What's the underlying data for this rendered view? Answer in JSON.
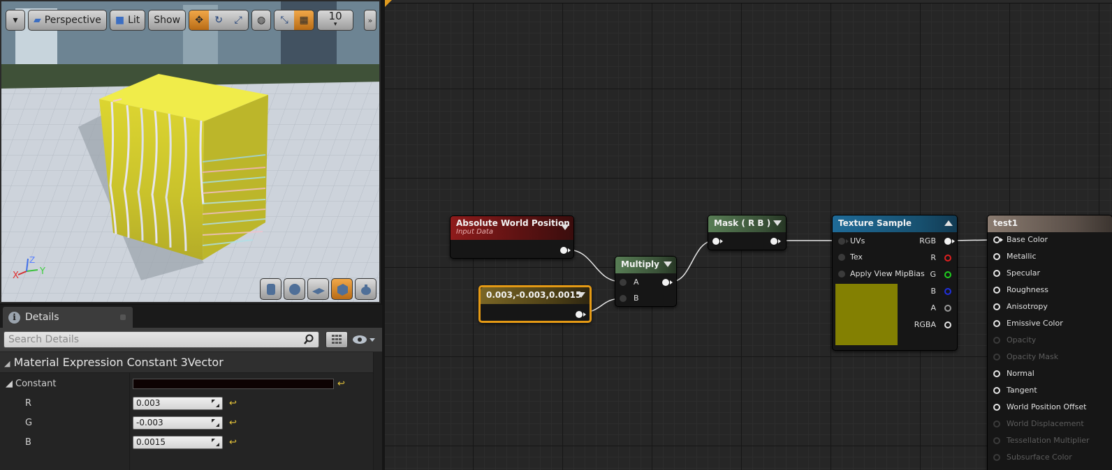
{
  "viewport": {
    "toolbar": {
      "perspective_label": "Perspective",
      "lit_label": "Lit",
      "show_label": "Show",
      "grid_snap_value": "10"
    },
    "axis": {
      "x": "X",
      "y": "Y",
      "z": "Z"
    }
  },
  "details": {
    "tab_title": "Details",
    "search_placeholder": "Search Details",
    "category_title": "Material Expression Constant 3Vector",
    "constant_label": "Constant",
    "constant_color": "#0d0202",
    "fields": [
      {
        "label": "R",
        "value": "0.003"
      },
      {
        "label": "G",
        "value": "-0.003"
      },
      {
        "label": "B",
        "value": "0.0015"
      }
    ]
  },
  "graph": {
    "nodes": {
      "absolute_world_position": {
        "title": "Absolute World Position",
        "subtitle": "Input Data",
        "color": "#8e1b1b"
      },
      "constant3": {
        "title": "0.003,-0.003,0.0015",
        "color": "#6a5a1e",
        "highlight": "#e59a14"
      },
      "multiply": {
        "title": "Multiply",
        "inputs": [
          "A",
          "B"
        ],
        "color": "#4d6b4a"
      },
      "mask": {
        "title": "Mask ( R B )",
        "color": "#4d6b4a"
      },
      "texture_sample": {
        "title": "Texture Sample",
        "inputs": [
          "UVs",
          "Tex",
          "Apply View MipBias"
        ],
        "outputs": [
          "RGB",
          "R",
          "G",
          "B",
          "A",
          "RGBA"
        ],
        "preview_color": "#838002",
        "color": "#1b5f86"
      },
      "result": {
        "title": "test1",
        "inputs_active": [
          "Base Color",
          "Metallic",
          "Specular",
          "Roughness",
          "Anisotropy",
          "Emissive Color"
        ],
        "inputs_inactive_1": [
          "Opacity",
          "Opacity Mask"
        ],
        "inputs_active_2": [
          "Normal",
          "Tangent",
          "World Position Offset"
        ],
        "inputs_inactive_2": [
          "World Displacement",
          "Tessellation Multiplier",
          "Subsurface Color"
        ],
        "color": "#7a6d63"
      }
    }
  }
}
